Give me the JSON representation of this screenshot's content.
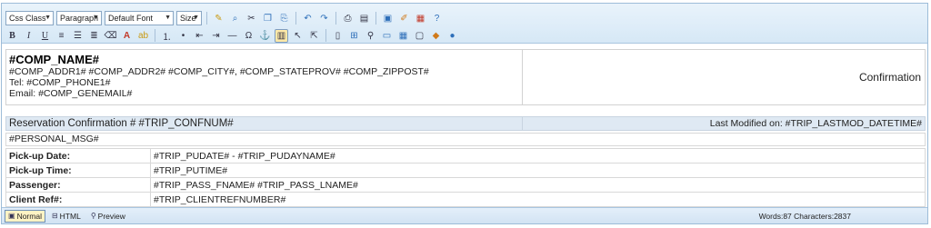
{
  "toolbar": {
    "css_class": "Css Class",
    "paragraph": "Paragraph",
    "font": "Default Font",
    "size": "Size",
    "row1_icons": [
      "spellcheck-icon",
      "find-icon",
      "cut-icon",
      "copy-icon",
      "paste-icon",
      "undo-icon",
      "redo-icon",
      "print-icon",
      "preview-icon",
      "insert-image-icon",
      "insert-file-icon",
      "insert-pdf-icon",
      "help-icon"
    ],
    "row2_icons": [
      "bold-icon",
      "italic-icon",
      "underline-icon",
      "align-left-icon",
      "align-center-icon",
      "align-right-icon",
      "eraser-icon",
      "font-color-icon",
      "highlight-icon",
      "ordered-list-icon",
      "unordered-list-icon",
      "outdent-icon",
      "indent-icon",
      "horizontal-rule-icon",
      "special-char-icon",
      "anchor-icon",
      "show-borders-icon",
      "select-icon",
      "pointer-icon",
      "new-doc-icon",
      "image-map-icon",
      "find-replace-icon",
      "form-icon",
      "table-icon",
      "frame-icon",
      "template-icon",
      "plugin-icon"
    ]
  },
  "content": {
    "company_name": "#COMP_NAME#",
    "address": "#COMP_ADDR1# #COMP_ADDR2# #COMP_CITY#, #COMP_STATEPROV# #COMP_ZIPPOST#",
    "tel": "Tel: #COMP_PHONE1#",
    "email": "Email: #COMP_GENEMAIL#",
    "doc_title": "Confirmation",
    "confirmation_label": "Reservation Confirmation # #TRIP_CONFNUM#",
    "last_modified": "Last Modified on: #TRIP_LASTMOD_DATETIME#",
    "personal_msg": "#PERSONAL_MSG#",
    "rows": [
      {
        "label": "Pick-up Date:",
        "value": "#TRIP_PUDATE# - #TRIP_PUDAYNAME#"
      },
      {
        "label": "Pick-up Time:",
        "value": "#TRIP_PUTIME#"
      },
      {
        "label": "Passenger:",
        "value": "#TRIP_PASS_FNAME# #TRIP_PASS_LNAME#"
      },
      {
        "label": "Client Ref#:",
        "value": "#TRIP_CLIENTREFNUMBER#"
      }
    ]
  },
  "footer": {
    "normal": "Normal",
    "html": "HTML",
    "preview": "Preview",
    "counts": "Words:87 Characters:2837"
  }
}
